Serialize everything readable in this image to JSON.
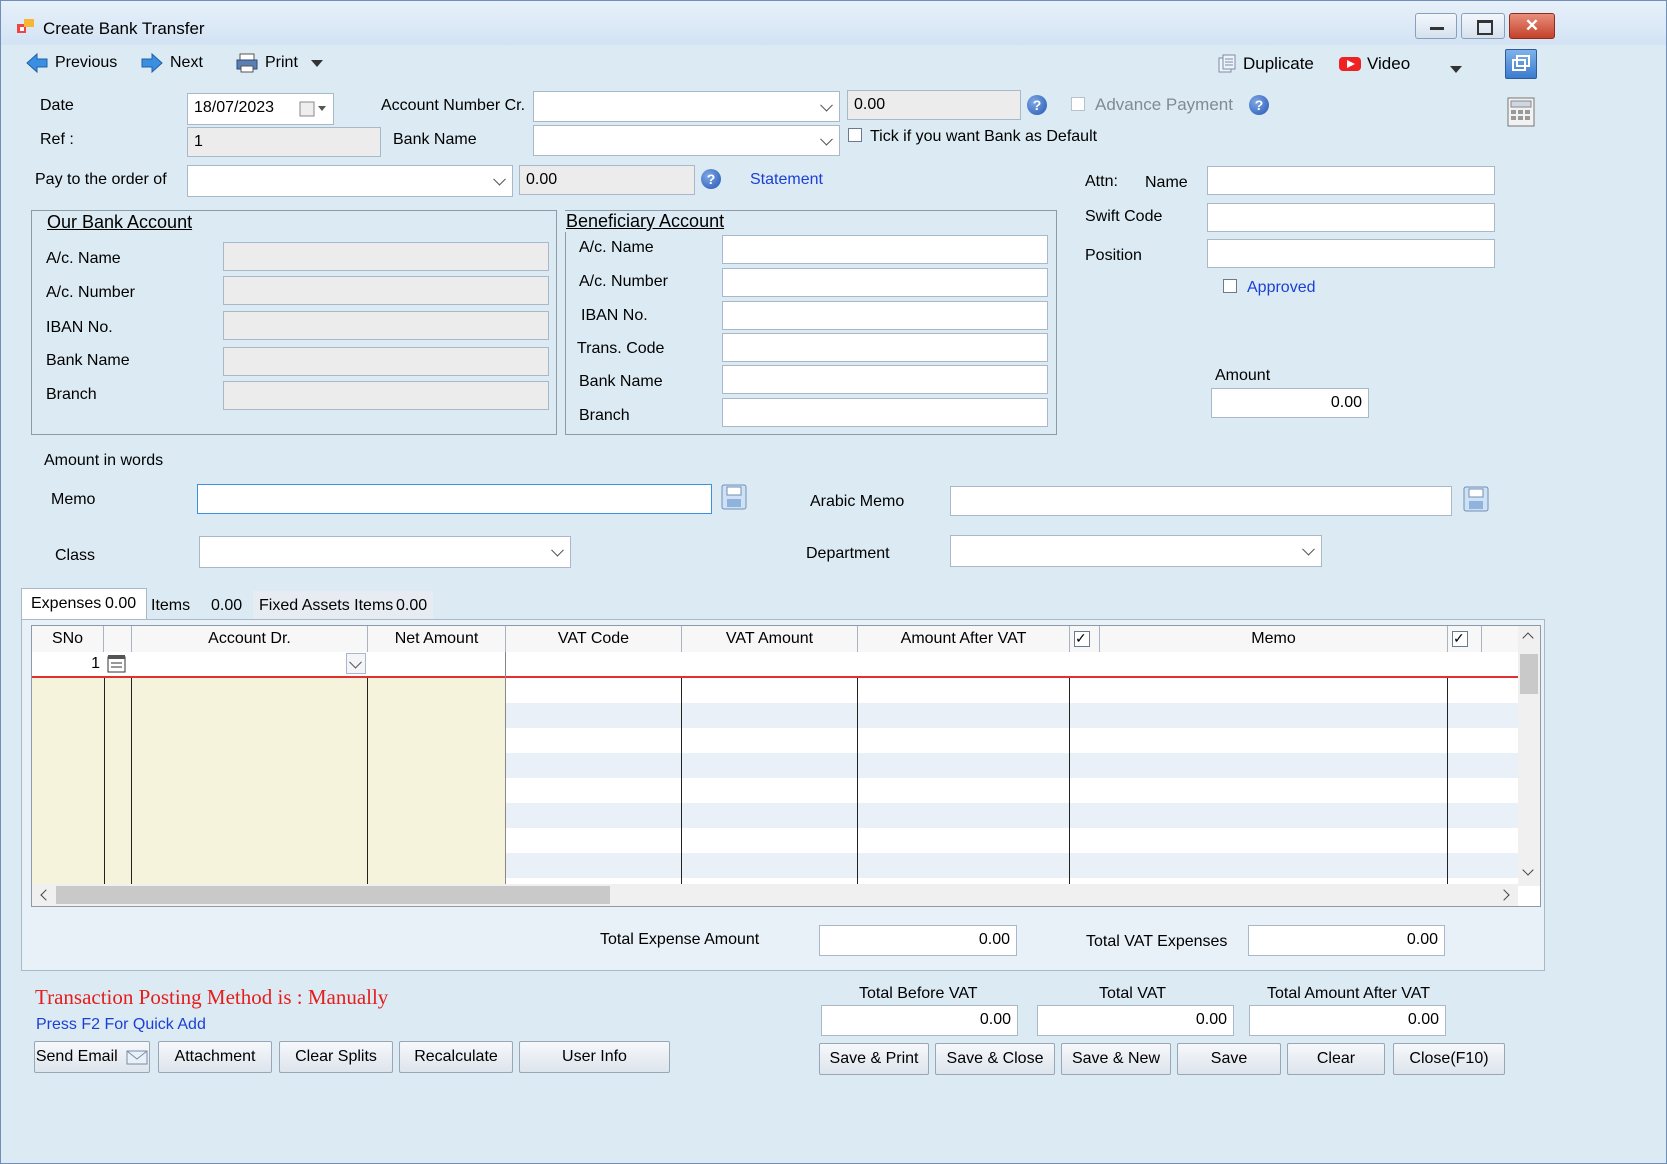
{
  "window": {
    "title": "Create Bank Transfer"
  },
  "toolbar": {
    "previous": "Previous",
    "next": "Next",
    "print": "Print",
    "duplicate": "Duplicate",
    "video": "Video"
  },
  "header": {
    "date_label": "Date",
    "date_value": "18/07/2023",
    "ref_label": "Ref :",
    "ref_value": "1",
    "account_number_cr_label": "Account Number Cr.",
    "account_number_cr_value": "",
    "account_amount": "0.00",
    "advance_payment_label": "Advance Payment",
    "bank_name_label": "Bank Name",
    "bank_name_value": "",
    "default_bank_label": "Tick if you want Bank as Default",
    "pay_to_label": "Pay to the order of",
    "pay_to_value": "",
    "pay_to_amount": "0.00",
    "statement_link": "Statement"
  },
  "attn": {
    "attn_label": "Attn:",
    "name_label": "Name",
    "name_value": "",
    "swift_label": "Swift Code",
    "swift_value": "",
    "position_label": "Position",
    "position_value": "",
    "approved_label": "Approved",
    "amount_label": "Amount",
    "amount_value": "0.00"
  },
  "our_bank": {
    "title": "Our Bank Account",
    "ac_name": "A/c. Name",
    "ac_number": "A/c. Number",
    "iban": "IBAN No.",
    "bank_name": "Bank Name",
    "branch": "Branch"
  },
  "beneficiary": {
    "title": "Beneficiary Account",
    "ac_name": "A/c. Name",
    "ac_number": "A/c. Number",
    "iban": "IBAN No.",
    "trans_code": "Trans. Code",
    "bank_name": "Bank Name",
    "branch": "Branch"
  },
  "memo_section": {
    "amount_in_words_label": "Amount in words",
    "memo_label": "Memo",
    "memo_value": "",
    "arabic_memo_label": "Arabic Memo",
    "arabic_memo_value": "",
    "class_label": "Class",
    "class_value": "",
    "department_label": "Department",
    "department_value": ""
  },
  "tabs": [
    {
      "label": "Expenses",
      "amount": "0.00"
    },
    {
      "label": "Items",
      "amount": "0.00"
    },
    {
      "label": "Fixed Assets Items",
      "amount": "0.00"
    }
  ],
  "grid": {
    "columns": {
      "sno": "SNo",
      "account_dr": "Account Dr.",
      "net_amount": "Net Amount",
      "vat_code": "VAT Code",
      "vat_amount": "VAT Amount",
      "amount_after_vat": "Amount After VAT",
      "memo": "Memo"
    },
    "rows": [
      {
        "sno": "1",
        "account_dr": "",
        "net_amount": ""
      }
    ]
  },
  "totals": {
    "total_expense_label": "Total Expense Amount",
    "total_expense_value": "0.00",
    "total_vat_expenses_label": "Total VAT Expenses",
    "total_vat_expenses_value": "0.00",
    "total_before_vat_label": "Total Before VAT",
    "total_before_vat_value": "0.00",
    "total_vat_label": "Total VAT",
    "total_vat_value": "0.00",
    "total_after_vat_label": "Total Amount After VAT",
    "total_after_vat_value": "0.00"
  },
  "footer": {
    "posting_method": "Transaction Posting Method is : Manually",
    "quick_add_hint": "Press F2 For Quick Add",
    "send_email": "Send Email",
    "attachment": "Attachment",
    "clear_splits": "Clear Splits",
    "recalculate": "Recalculate",
    "user_info": "User Info",
    "save_print": "Save & Print",
    "save_close": "Save & Close",
    "save_new": "Save & New",
    "save": "Save",
    "clear": "Clear",
    "close": "Close(F10)"
  },
  "colors": {
    "window_bg": "#dcebf3",
    "link_blue": "#1a3fd6",
    "posting_red": "#e41d1d",
    "grid_cream": "#f5f3dc",
    "grid_stripe": "#e9f0f7",
    "current_row_line": "#e03030"
  }
}
